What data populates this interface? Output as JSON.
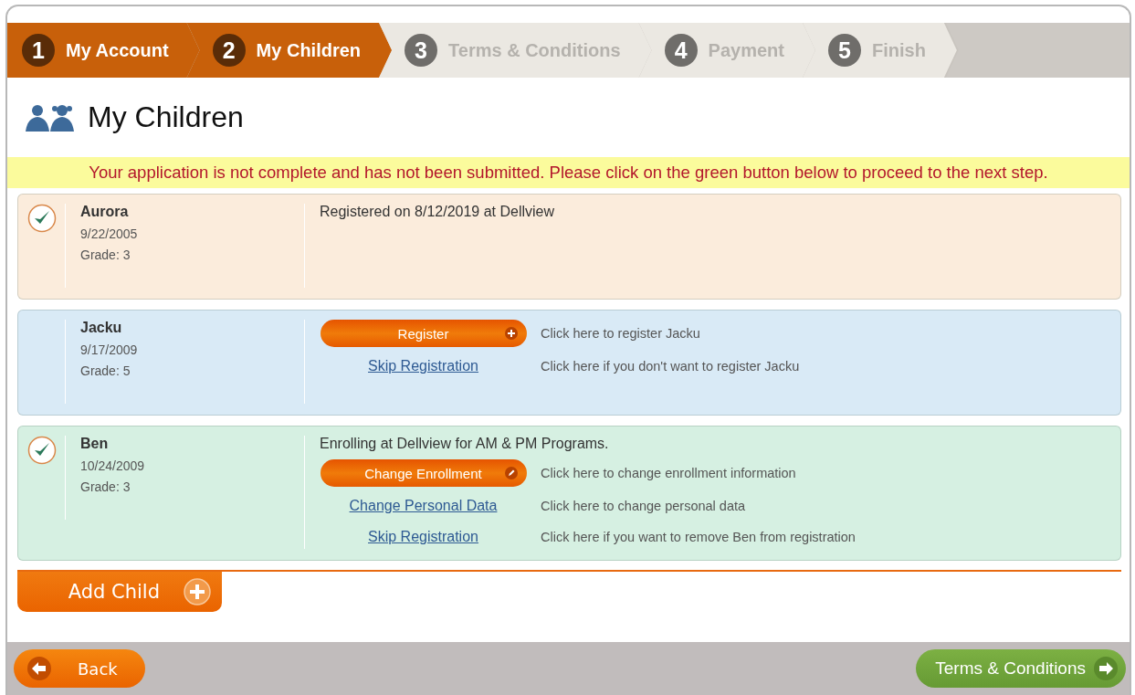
{
  "steps": [
    {
      "number": "1",
      "label": "My Account",
      "active": true
    },
    {
      "number": "2",
      "label": "My Children",
      "active": true
    },
    {
      "number": "3",
      "label": "Terms & Conditions",
      "active": false
    },
    {
      "number": "4",
      "label": "Payment",
      "active": false
    },
    {
      "number": "5",
      "label": "Finish",
      "active": false
    }
  ],
  "page_title": "My Children",
  "alert": "Your application is not complete and has not been submitted. Please click on the green button below to proceed to the next step.",
  "children": [
    {
      "name": "Aurora",
      "birthdate": "9/22/2005",
      "grade": "Grade: 3",
      "color": "#fbecdc",
      "checked": true,
      "headline": "Registered on 8/12/2019 at Dellview"
    },
    {
      "name": "Jacku",
      "birthdate": "9/17/2009",
      "grade": "Grade: 5",
      "color": "#d9eaf6",
      "checked": false,
      "actions": [
        {
          "kind": "register",
          "label": "Register",
          "description": "Click here to register Jacku"
        },
        {
          "kind": "link",
          "label": "Skip Registration",
          "description": "Click here if you don't want to register Jacku"
        }
      ]
    },
    {
      "name": "Ben",
      "birthdate": "10/24/2009",
      "grade": "Grade: 3",
      "color": "#d6f0e2",
      "checked": true,
      "headline": "Enrolling at Dellview for AM & PM Programs.",
      "actions": [
        {
          "kind": "edit",
          "label": "Change Enrollment",
          "description": "Click here to change enrollment information"
        },
        {
          "kind": "link",
          "label": "Change Personal Data",
          "description": "Click here to change personal data"
        },
        {
          "kind": "link",
          "label": "Skip Registration",
          "description": "Click here if you want to remove Ben from registration"
        }
      ]
    }
  ],
  "add_child": "Add Child",
  "footer": {
    "back": "Back",
    "next": "Terms & Conditions"
  }
}
